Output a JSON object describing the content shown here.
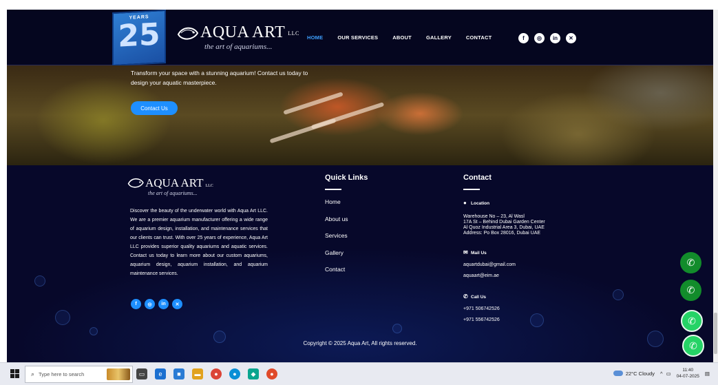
{
  "header": {
    "badge_top": "YEARS",
    "badge_number": "25",
    "brand": "AQUA ART",
    "brand_suffix": "LLC",
    "tagline": "the art of aquariums...",
    "nav": [
      "HOME",
      "OUR SERVICES",
      "ABOUT",
      "GALLERY",
      "CONTACT"
    ],
    "active_nav": "HOME",
    "social_icons": [
      "facebook-icon",
      "instagram-icon",
      "linkedin-icon",
      "x-icon"
    ]
  },
  "hero": {
    "text": "Transform your space with a stunning aquarium! Contact us today to design your aquatic masterpiece.",
    "button": "Contact Us"
  },
  "footer": {
    "brand": "AQUA ART",
    "brand_suffix": "LLC",
    "tagline": "the art of aquariums...",
    "about": "Discover the beauty of the underwater world with Aqua Art LLC. We are a premier aquarium manufacturer offering a wide range of aquarium design, installation, and maintenance services that our clients can trust. With over 25 years of experience, Aqua Art LLC provides superior quality aquariums and aquatic services. Contact us today to learn more about our custom aquariums, aquarium design, aquarium installation, and aquarium maintenance services.",
    "quick_links_title": "Quick Links",
    "quick_links": [
      "Home",
      "About us",
      "Services",
      "Gallery",
      "Contact"
    ],
    "contact_title": "Contact",
    "location_label": "Location",
    "address": [
      "Warehouse No – 23, Al Wasl",
      "17A St – Behind Dubai Garden Center",
      "Al Quoz Industrial Area 3, Dubai, UAE",
      "Address: Po Box 28016, Dubai UAE"
    ],
    "mail_label": "Mail Us",
    "emails": [
      "aquartdubai@gmail.com",
      "aquaart@eim.ae"
    ],
    "call_label": "Call Us",
    "phones": [
      "+971 506742526",
      "+971 556742526"
    ],
    "copyright": "Copyright © 2025 Aqua Art, All rights reserved."
  },
  "taskbar": {
    "search_placeholder": "Type here to search",
    "weather": "22°C  Cloudy",
    "time": "11:40",
    "date": "04-07-2025"
  },
  "colors": {
    "navy": "#07082a",
    "accent_blue": "#1e8fff",
    "call_green": "#128c2b",
    "whatsapp_green": "#25d366"
  }
}
